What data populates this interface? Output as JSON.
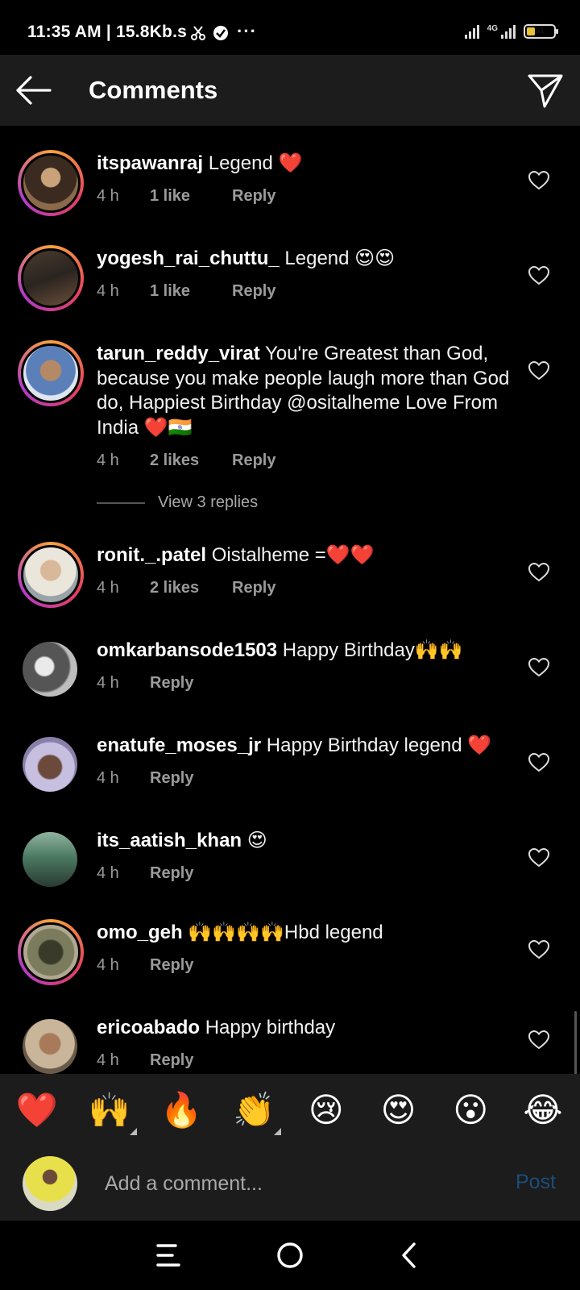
{
  "status_bar": {
    "left_text": "11:35 AM | 15.8Kb.s",
    "network": "4G",
    "battery": "31",
    "battery_level": 0.31
  },
  "header": {
    "title": "Comments"
  },
  "comments": [
    {
      "user": "itspawanraj",
      "text": " Legend ❤️",
      "time": "4 h",
      "likes": "1 like",
      "reply": "Reply"
    },
    {
      "user": "yogesh_rai_chuttu_",
      "text": " Legend 😍😍",
      "time": "4 h",
      "likes": "1 like",
      "reply": "Reply"
    },
    {
      "user": "tarun_reddy_virat",
      "text": " You're Greatest than God, because you make people laugh more than God do,  Happiest Birthday @ositalheme Love From India ❤️🇮🇳",
      "time": "4 h",
      "likes": "2 likes",
      "reply": "Reply"
    },
    {
      "user": "ronit._.patel",
      "text": " Oistalheme =❤️❤️",
      "time": "4 h",
      "likes": "2 likes",
      "reply": "Reply"
    },
    {
      "user": "omkarbansode1503",
      "text": " Happy Birthday🙌🙌",
      "time": "4 h",
      "likes": "",
      "reply": "Reply"
    },
    {
      "user": "enatufe_moses_jr",
      "text": " Happy Birthday legend ❤️",
      "time": "4 h",
      "likes": "",
      "reply": "Reply"
    },
    {
      "user": "its_aatish_khan",
      "text": " 😍",
      "time": "4 h",
      "likes": "",
      "reply": "Reply"
    },
    {
      "user": "omo_geh",
      "text": " 🙌🙌🙌🙌Hbd legend",
      "time": "4 h",
      "likes": "",
      "reply": "Reply"
    },
    {
      "user": "ericoabado",
      "text": " Happy birthday",
      "time": "4 h",
      "likes": "",
      "reply": "Reply"
    }
  ],
  "view_replies": "View 3 replies",
  "reactions": [
    "❤️",
    "🙌",
    "🔥",
    "👏",
    "😢",
    "😍",
    "😮",
    "😂"
  ],
  "composer": {
    "placeholder": "Add a comment...",
    "post_label": "Post"
  },
  "colors": {
    "background": "#000000",
    "surface": "#1c1c1c",
    "muted_text": "#9a9a9a",
    "post_disabled": "#1b4d7a"
  }
}
